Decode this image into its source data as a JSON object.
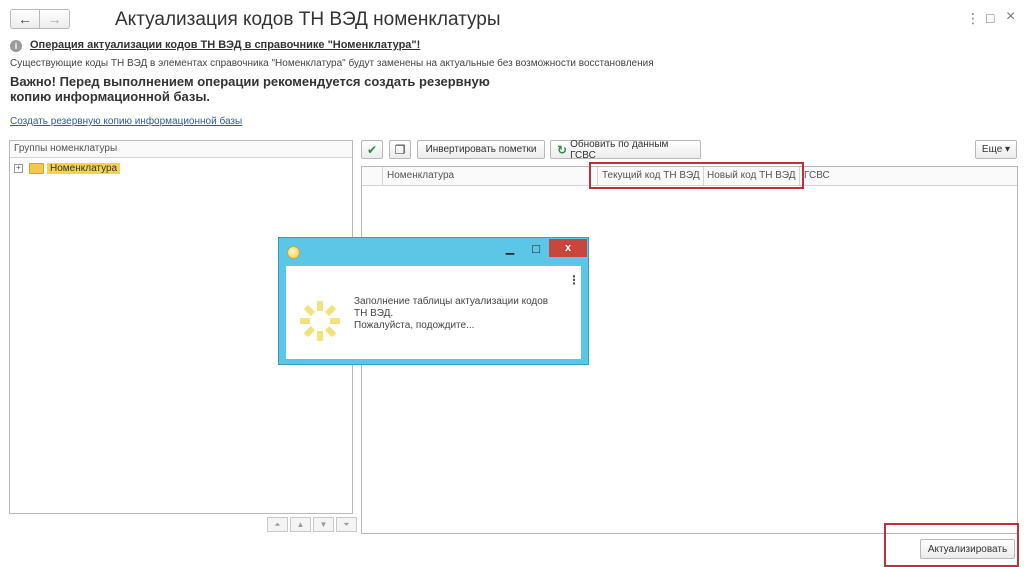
{
  "nav": {
    "back_icon": "←",
    "forward_icon": "→"
  },
  "window": {
    "title": "Актуализация кодов ТН ВЭД номенклатуры",
    "menu_icon": "⋮",
    "maximize_icon": "□",
    "close_icon": "×"
  },
  "notice": {
    "info_icon": "i",
    "heading": "Операция актуализации кодов ТН ВЭД в справочнике \"Номенклатура\"!",
    "description": "Существующие коды ТН ВЭД в элементах справочника \"Номенклатура\" будут заменены на актуальные без возможности восстановления",
    "important": "Важно! Перед выполнением операции рекомендуется создать резервную копию информационной базы.",
    "backup_link": "Создать резервную копию информационной базы"
  },
  "groups_panel": {
    "header": "Группы номенклатуры",
    "expand_icon": "+",
    "tree_items": [
      {
        "label": "Номенклатура"
      }
    ],
    "scroll_icons": [
      "⏶",
      "▲",
      "▼",
      "⏷"
    ]
  },
  "toolbar": {
    "check_all_icon": "✔",
    "copy_icon": "❐",
    "invert_label": "Инвертировать пометки",
    "refresh_icon": "↻",
    "refresh_label": "Обновить по данным ГСВС",
    "more_label": "Еще ▾"
  },
  "table": {
    "columns": [
      "Номенклатура",
      "Текущий код ТН ВЭД",
      "Новый код ТН ВЭД",
      "ГСВС"
    ],
    "rows": []
  },
  "dialog": {
    "minimize_icon": "▁",
    "maximize_icon": "□",
    "close_icon": "x",
    "more_icon": "⋮",
    "message_line1": "Заполнение таблицы актуализации кодов ТН ВЭД.",
    "message_line2": "Пожалуйста, подождите..."
  },
  "footer": {
    "update_button": "Актуализировать"
  },
  "colors": {
    "highlight_red": "#c0303a",
    "dialog_blue": "#5bc6e6",
    "folder_yellow": "#f7d24a",
    "link_blue": "#2a5d9f"
  }
}
